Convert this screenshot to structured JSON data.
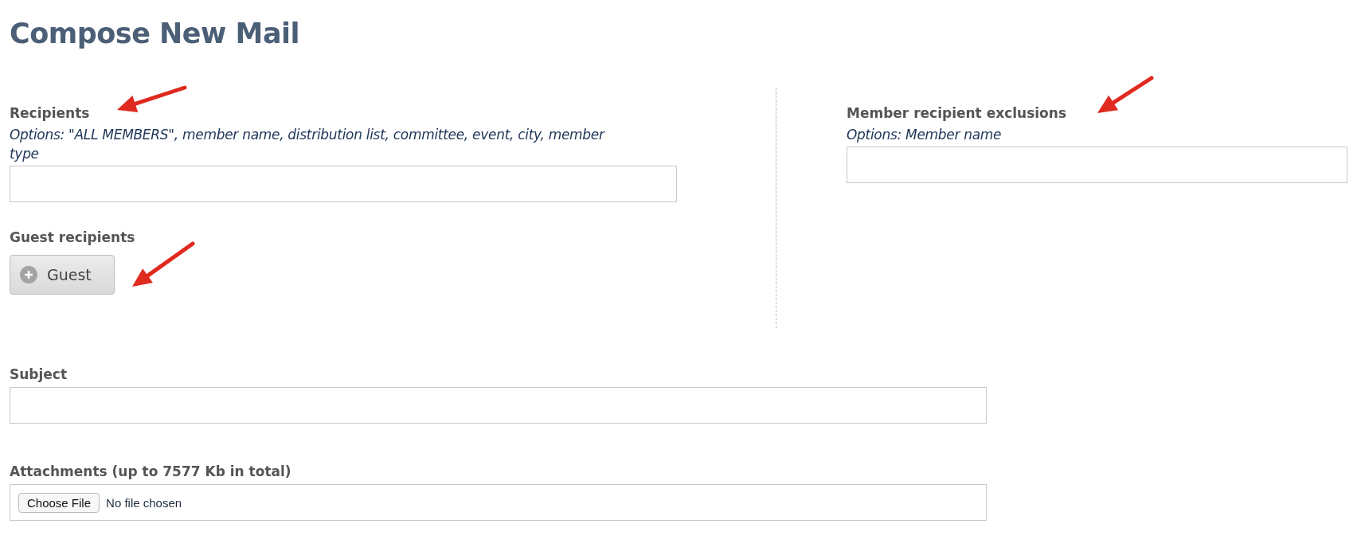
{
  "title": "Compose New Mail",
  "recipients": {
    "label": "Recipients",
    "hint": "Options: \"ALL MEMBERS\", member name, distribution list, committee, event, city, member type"
  },
  "guest_recipients": {
    "label": "Guest recipients",
    "button": "Guest"
  },
  "member_exclusions": {
    "label": "Member recipient exclusions",
    "hint": "Options: Member name"
  },
  "subject": {
    "label": "Subject"
  },
  "attachments": {
    "label": "Attachments (up to 7577 Kb in total)",
    "button": "Choose File",
    "status": "No file chosen"
  }
}
